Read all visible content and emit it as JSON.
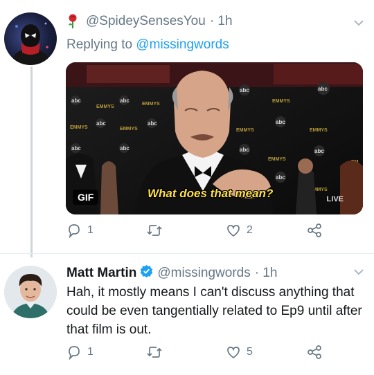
{
  "tweet1": {
    "handle": "@SpideySensesYou",
    "time": "· 1h",
    "replying_label": "Replying to",
    "replying_to": "@missingwords",
    "media": {
      "badge": "GIF",
      "caption": "What does that mean?",
      "live_label": "LIVE",
      "logo_text": "abc",
      "emmys_text": "EMMYS"
    },
    "actions": {
      "replies": "1",
      "retweets": "",
      "likes": "2"
    }
  },
  "tweet2": {
    "name": "Matt Martin",
    "handle": "@missingwords",
    "time": "· 1h",
    "text": "Hah, it mostly means I can't discuss anything that could be even tangentially related to Ep9 until after that film is out.",
    "actions": {
      "replies": "1",
      "retweets": "",
      "likes": "5"
    }
  },
  "colors": {
    "link": "#1da1f2",
    "muted": "#657786",
    "verified": "#1da1f2",
    "caption": "#ffe14a"
  },
  "icons": [
    "rose-emoji-icon",
    "chevron-down-icon",
    "reply-icon",
    "retweet-icon",
    "like-icon",
    "share-icon",
    "verified-badge-icon"
  ]
}
